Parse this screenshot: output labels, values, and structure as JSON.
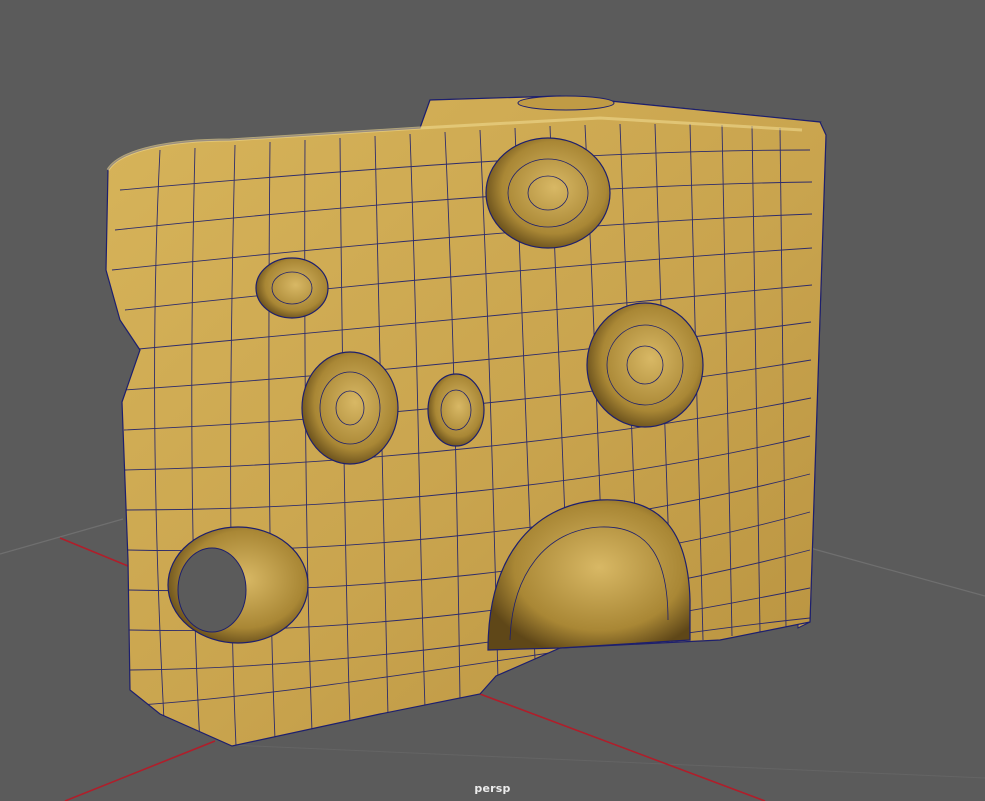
{
  "viewport": {
    "camera_name": "persp",
    "background_color": "#5b5b5b",
    "grid_line_color": "#6d6d6d",
    "grid_axis_x_color": "#b01e2a"
  },
  "model": {
    "object": "cheese-wedge",
    "surface_color": "#c9a44e",
    "surface_highlight": "#e2c46d",
    "surface_shadow": "#8d6e2c",
    "wire_color": "#1d1f6e",
    "holes": 8
  }
}
